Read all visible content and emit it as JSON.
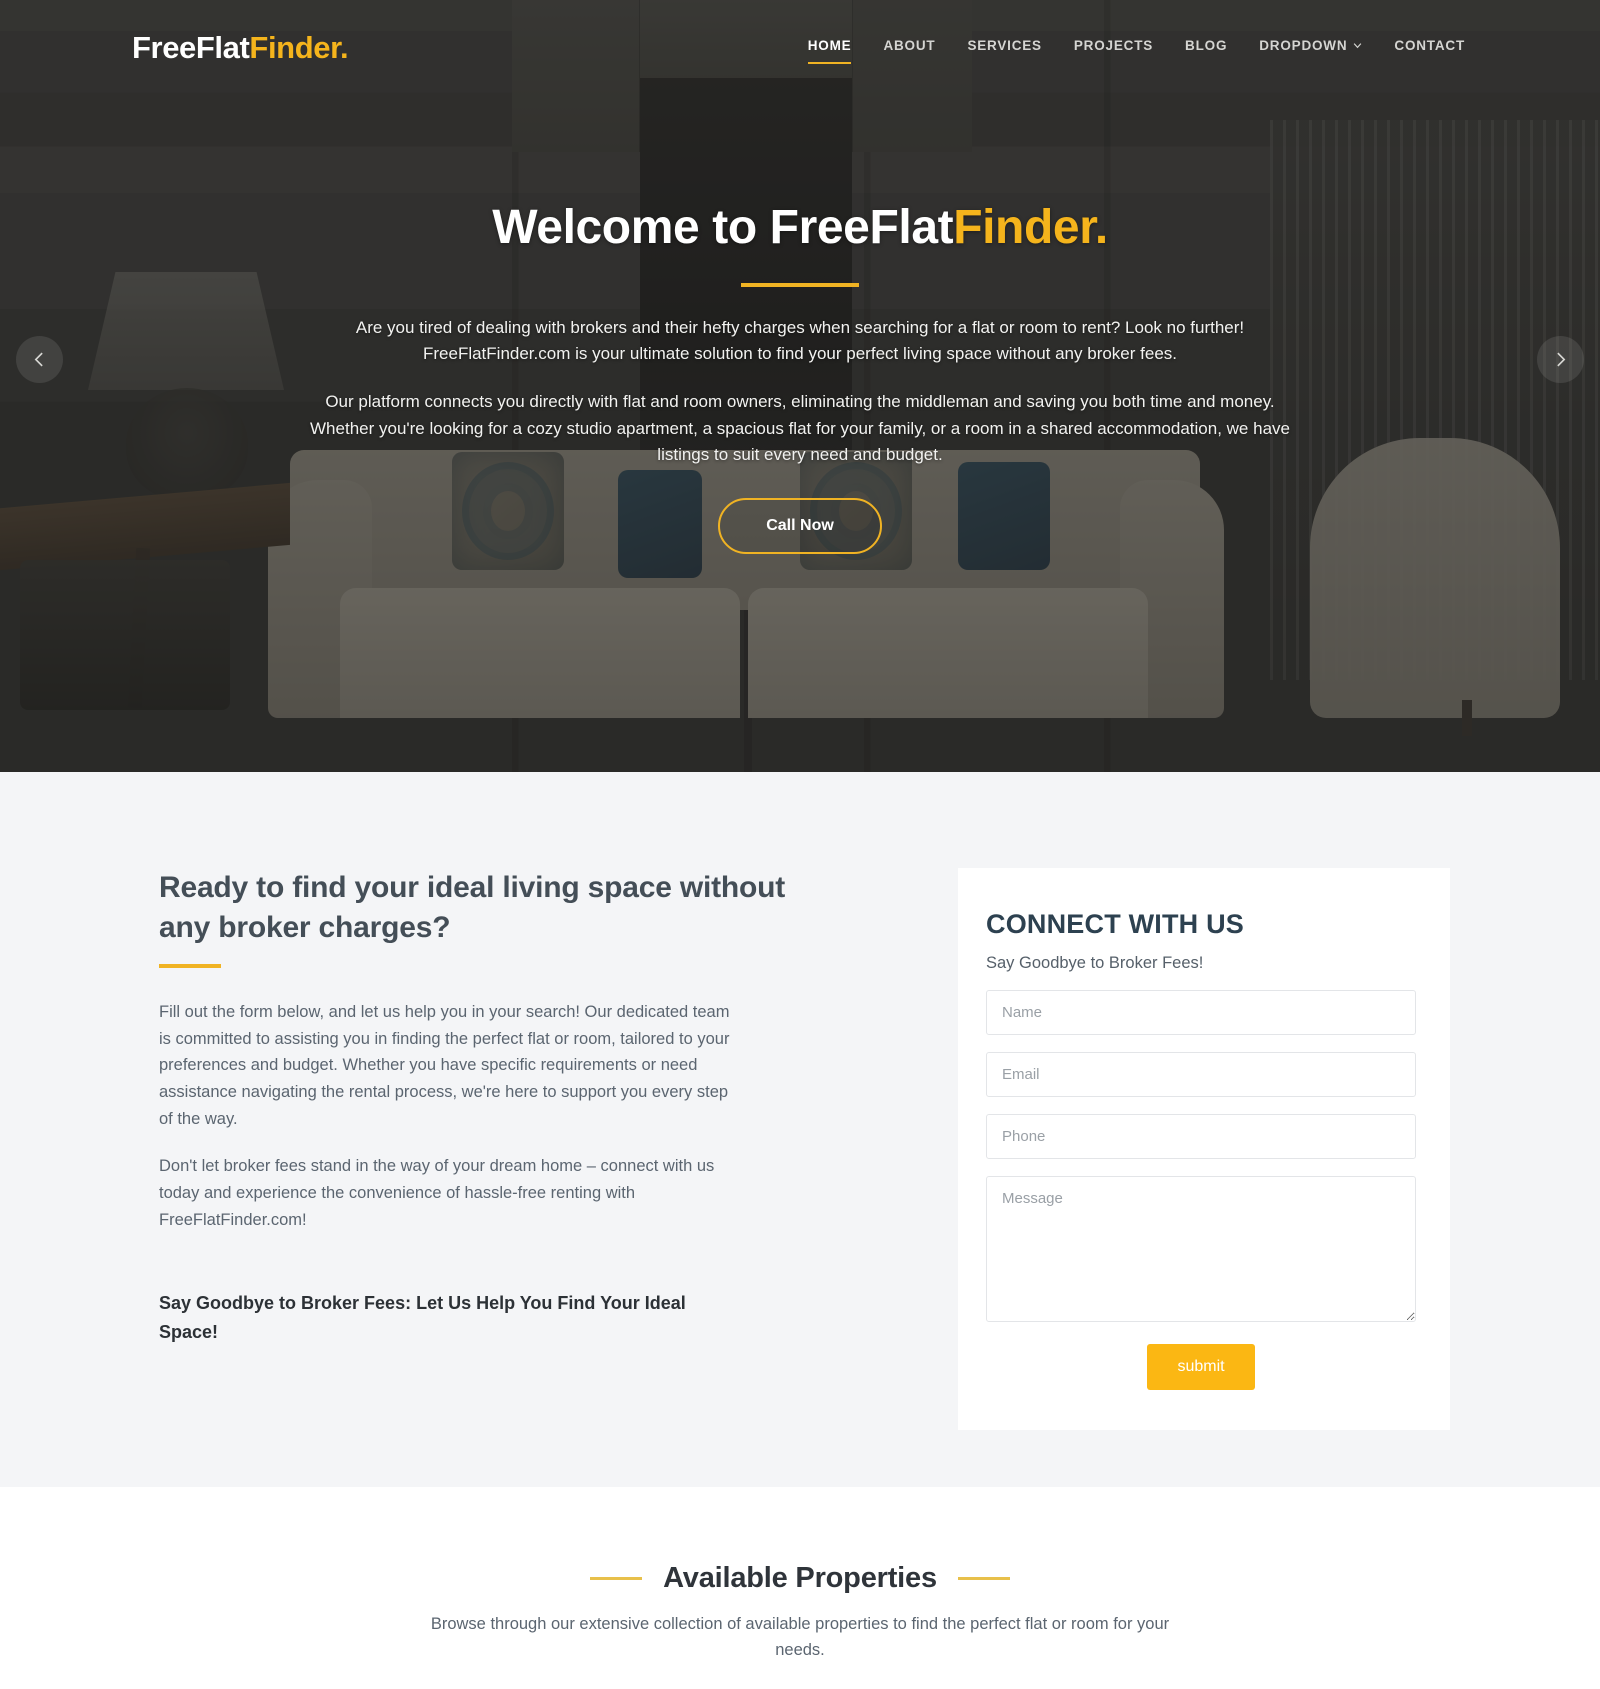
{
  "brand": {
    "name_plain": "FreeFlat",
    "name_accent": "Finder.",
    "accent_color": "#f5b41c"
  },
  "nav": {
    "items": [
      {
        "label": "HOME",
        "active": true
      },
      {
        "label": "ABOUT",
        "active": false
      },
      {
        "label": "SERVICES",
        "active": false
      },
      {
        "label": "PROJECTS",
        "active": false
      },
      {
        "label": "BLOG",
        "active": false
      },
      {
        "label": "DROPDOWN",
        "active": false,
        "icon": "chevron-down-icon"
      },
      {
        "label": "CONTACT",
        "active": false
      }
    ]
  },
  "hero": {
    "title_plain": "Welcome to FreeFlat",
    "title_accent": "Finder.",
    "paragraph_1": "Are you tired of dealing with brokers and their hefty charges when searching for a flat or room to rent? Look no further! FreeFlatFinder.com is your ultimate solution to find your perfect living space without any broker fees.",
    "paragraph_2": "Our platform connects you directly with flat and room owners, eliminating the middleman and saving you both time and money. Whether you're looking for a cozy studio apartment, a spacious flat for your family, or a room in a shared accommodation, we have listings to suit every need and budget.",
    "cta_label": "Call Now",
    "prev_icon": "chevron-left-icon",
    "next_icon": "chevron-right-icon"
  },
  "connect": {
    "heading": "Ready to find your ideal living space without any broker charges?",
    "paragraph_1": "Fill out the form below, and let us help you in your search! Our dedicated team is committed to assisting you in finding the perfect flat or room, tailored to your preferences and budget. Whether you have specific requirements or need assistance navigating the rental process, we're here to support you every step of the way.",
    "paragraph_2": "Don't let broker fees stand in the way of your dream home – connect with us today and experience the convenience of hassle-free renting with FreeFlatFinder.com!",
    "highlight": "Say Goodbye to Broker Fees: Let Us Help You Find Your Ideal Space!",
    "form": {
      "title": "CONNECT WITH US",
      "subtitle": "Say Goodbye to Broker Fees!",
      "name_placeholder": "Name",
      "name_value": "",
      "email_placeholder": "Email",
      "email_value": "",
      "phone_placeholder": "Phone",
      "phone_value": "",
      "message_placeholder": "Message",
      "message_value": "",
      "submit_label": "submit",
      "submit_color": "#fbb713"
    }
  },
  "properties": {
    "title": "Available Properties",
    "subtitle": "Browse through our extensive collection of available properties to find the perfect flat or room for your needs."
  }
}
